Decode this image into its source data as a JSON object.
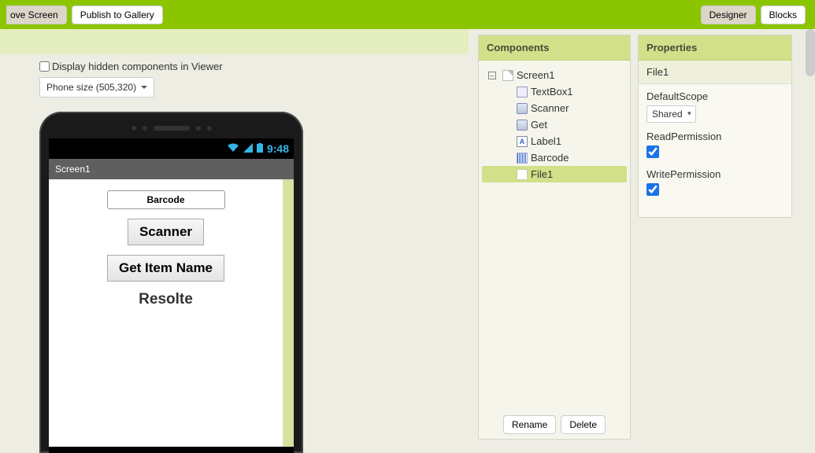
{
  "topbar": {
    "remove_screen": "ove Screen",
    "publish_gallery": "Publish to Gallery",
    "designer": "Designer",
    "blocks": "Blocks"
  },
  "viewer": {
    "hidden_label": "Display hidden components in Viewer",
    "phone_size": "Phone size (505,320)",
    "status_time": "9:48",
    "screen_title": "Screen1",
    "textbox_hint": "Barcode",
    "scanner_btn": "Scanner",
    "get_item_btn": "Get Item Name",
    "result_label": "Resolte"
  },
  "components": {
    "header": "Components",
    "tree": {
      "screen": "Screen1",
      "items": [
        {
          "name": "TextBox1",
          "icon": "textbox"
        },
        {
          "name": "Scanner",
          "icon": "button"
        },
        {
          "name": "Get",
          "icon": "button"
        },
        {
          "name": "Label1",
          "icon": "label"
        },
        {
          "name": "Barcode",
          "icon": "barcode"
        },
        {
          "name": "File1",
          "icon": "file",
          "selected": true
        }
      ]
    },
    "rename": "Rename",
    "delete": "Delete"
  },
  "properties": {
    "header": "Properties",
    "component_name": "File1",
    "default_scope_label": "DefaultScope",
    "default_scope_value": "Shared",
    "read_perm_label": "ReadPermission",
    "read_perm_checked": true,
    "write_perm_label": "WritePermission",
    "write_perm_checked": true
  }
}
